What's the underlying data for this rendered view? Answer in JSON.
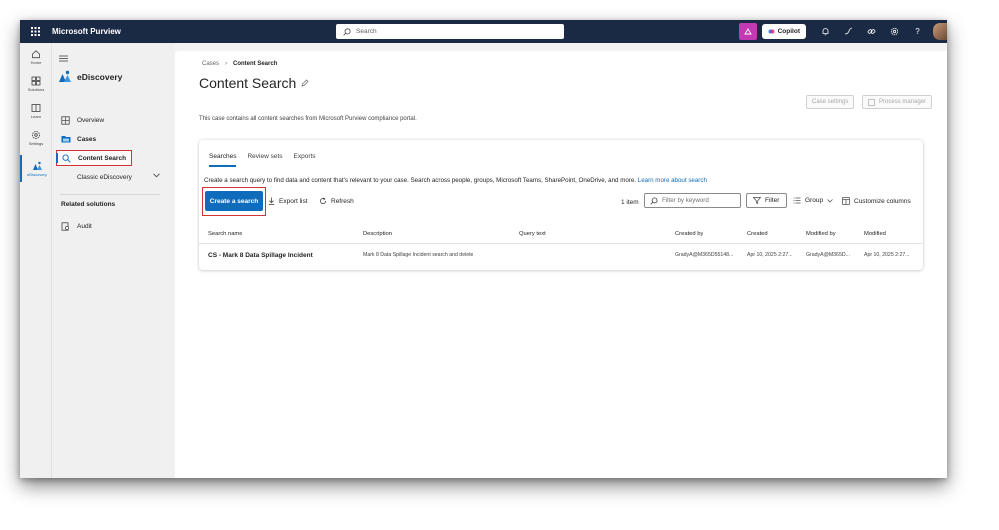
{
  "topbar": {
    "app_title": "Microsoft Purview",
    "search_placeholder": "Search",
    "copilot_label": "Copilot"
  },
  "rail": {
    "items": [
      {
        "label": "Home",
        "icon": "home-icon"
      },
      {
        "label": "Solutions",
        "icon": "grid-icon"
      },
      {
        "label": "Learn",
        "icon": "book-icon"
      },
      {
        "label": "Settings",
        "icon": "gear-icon"
      },
      {
        "label": "eDiscovery",
        "icon": "ediscovery-icon"
      }
    ]
  },
  "nav": {
    "title": "eDiscovery",
    "items": [
      {
        "label": "Overview",
        "icon": "overview-icon"
      },
      {
        "label": "Cases",
        "icon": "folder-icon"
      },
      {
        "label": "Content Search",
        "icon": "search-icon"
      },
      {
        "label": "Classic eDiscovery",
        "icon": "chevron-down-icon"
      }
    ],
    "related_title": "Related solutions",
    "related_items": [
      {
        "label": "Audit",
        "icon": "audit-icon"
      }
    ]
  },
  "main": {
    "breadcrumb": [
      "Cases",
      "Content Search"
    ],
    "title": "Content Search",
    "subtitle": "This case contains all content searches from Microsoft Purview compliance portal.",
    "case_settings_label": "Case settings",
    "process_manager_label": "Process manager",
    "tabs": [
      "Searches",
      "Review sets",
      "Exports"
    ],
    "description": "Create a search query to find data and content that's relevant to your case. Search across people, groups, Microsoft Teams, SharePoint, OneDrive, and more.",
    "learn_more": "Learn more about search",
    "create_label": "Create a search",
    "export_label": "Export list",
    "refresh_label": "Refresh",
    "item_count": "1 item",
    "filter_placeholder": "Filter by keyword",
    "filter_label": "Filter",
    "group_label": "Group",
    "customize_label": "Customize columns",
    "columns": [
      "Search name",
      "Description",
      "Query text",
      "Created by",
      "Created",
      "Modified by",
      "Modified"
    ],
    "rows": [
      {
        "name": "CS - Mark 8 Data Spillage Incident",
        "description": "Mark 8 Data Spillage Incident search and delete",
        "query": "",
        "created_by": "GradyA@M365D55148...",
        "created": "Apr 10, 2025 2:27...",
        "modified_by": "GradyA@M365D...",
        "modified": "Apr 10, 2025 2:27..."
      }
    ]
  },
  "colors": {
    "topbar": "#1b2a44",
    "accent": "#0f6cbd",
    "highlight": "#d13438",
    "copilot_purple": "#c239b3"
  }
}
